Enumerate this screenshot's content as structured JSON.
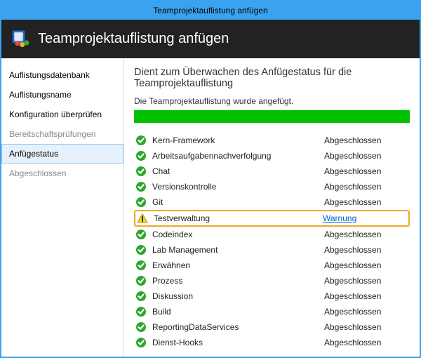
{
  "window": {
    "title": "Teamprojektauflistung anfügen"
  },
  "header": {
    "title": "Teamprojektauflistung anfügen"
  },
  "sidebar": {
    "items": [
      {
        "label": "Auflistungsdatenbank",
        "dim": false,
        "selected": false
      },
      {
        "label": "Auflistungsname",
        "dim": false,
        "selected": false
      },
      {
        "label": "Konfiguration überprüfen",
        "dim": false,
        "selected": false
      },
      {
        "label": "Bereitschaftsprüfungen",
        "dim": true,
        "selected": false
      },
      {
        "label": "Anfügestatus",
        "dim": false,
        "selected": true
      },
      {
        "label": "Abgeschlossen",
        "dim": true,
        "selected": false
      }
    ]
  },
  "main": {
    "title": "Dient zum Überwachen des Anfügestatus für die Teamprojektauflistung",
    "status_message": "Die Teamprojektauflistung wurde angefügt.",
    "progress_percent": 100,
    "rows": [
      {
        "icon": "ok",
        "name": "Kern-Framework",
        "status": "Abgeschlossen",
        "link": false,
        "highlight": false
      },
      {
        "icon": "ok",
        "name": "Arbeitsaufgabennachverfolgung",
        "status": "Abgeschlossen",
        "link": false,
        "highlight": false
      },
      {
        "icon": "ok",
        "name": "Chat",
        "status": "Abgeschlossen",
        "link": false,
        "highlight": false
      },
      {
        "icon": "ok",
        "name": "Versionskontrolle",
        "status": "Abgeschlossen",
        "link": false,
        "highlight": false
      },
      {
        "icon": "ok",
        "name": "Git",
        "status": "Abgeschlossen",
        "link": false,
        "highlight": false
      },
      {
        "icon": "warn",
        "name": "Testverwaltung",
        "status": "Warnung",
        "link": true,
        "highlight": true
      },
      {
        "icon": "ok",
        "name": "Codeindex",
        "status": "Abgeschlossen",
        "link": false,
        "highlight": false
      },
      {
        "icon": "ok",
        "name": "Lab Management",
        "status": "Abgeschlossen",
        "link": false,
        "highlight": false
      },
      {
        "icon": "ok",
        "name": "Erwähnen",
        "status": "Abgeschlossen",
        "link": false,
        "highlight": false
      },
      {
        "icon": "ok",
        "name": "Prozess",
        "status": "Abgeschlossen",
        "link": false,
        "highlight": false
      },
      {
        "icon": "ok",
        "name": "Diskussion",
        "status": "Abgeschlossen",
        "link": false,
        "highlight": false
      },
      {
        "icon": "ok",
        "name": "Build",
        "status": "Abgeschlossen",
        "link": false,
        "highlight": false
      },
      {
        "icon": "ok",
        "name": "ReportingDataServices",
        "status": "Abgeschlossen",
        "link": false,
        "highlight": false
      },
      {
        "icon": "ok",
        "name": "Dienst-Hooks",
        "status": "Abgeschlossen",
        "link": false,
        "highlight": false
      }
    ]
  }
}
